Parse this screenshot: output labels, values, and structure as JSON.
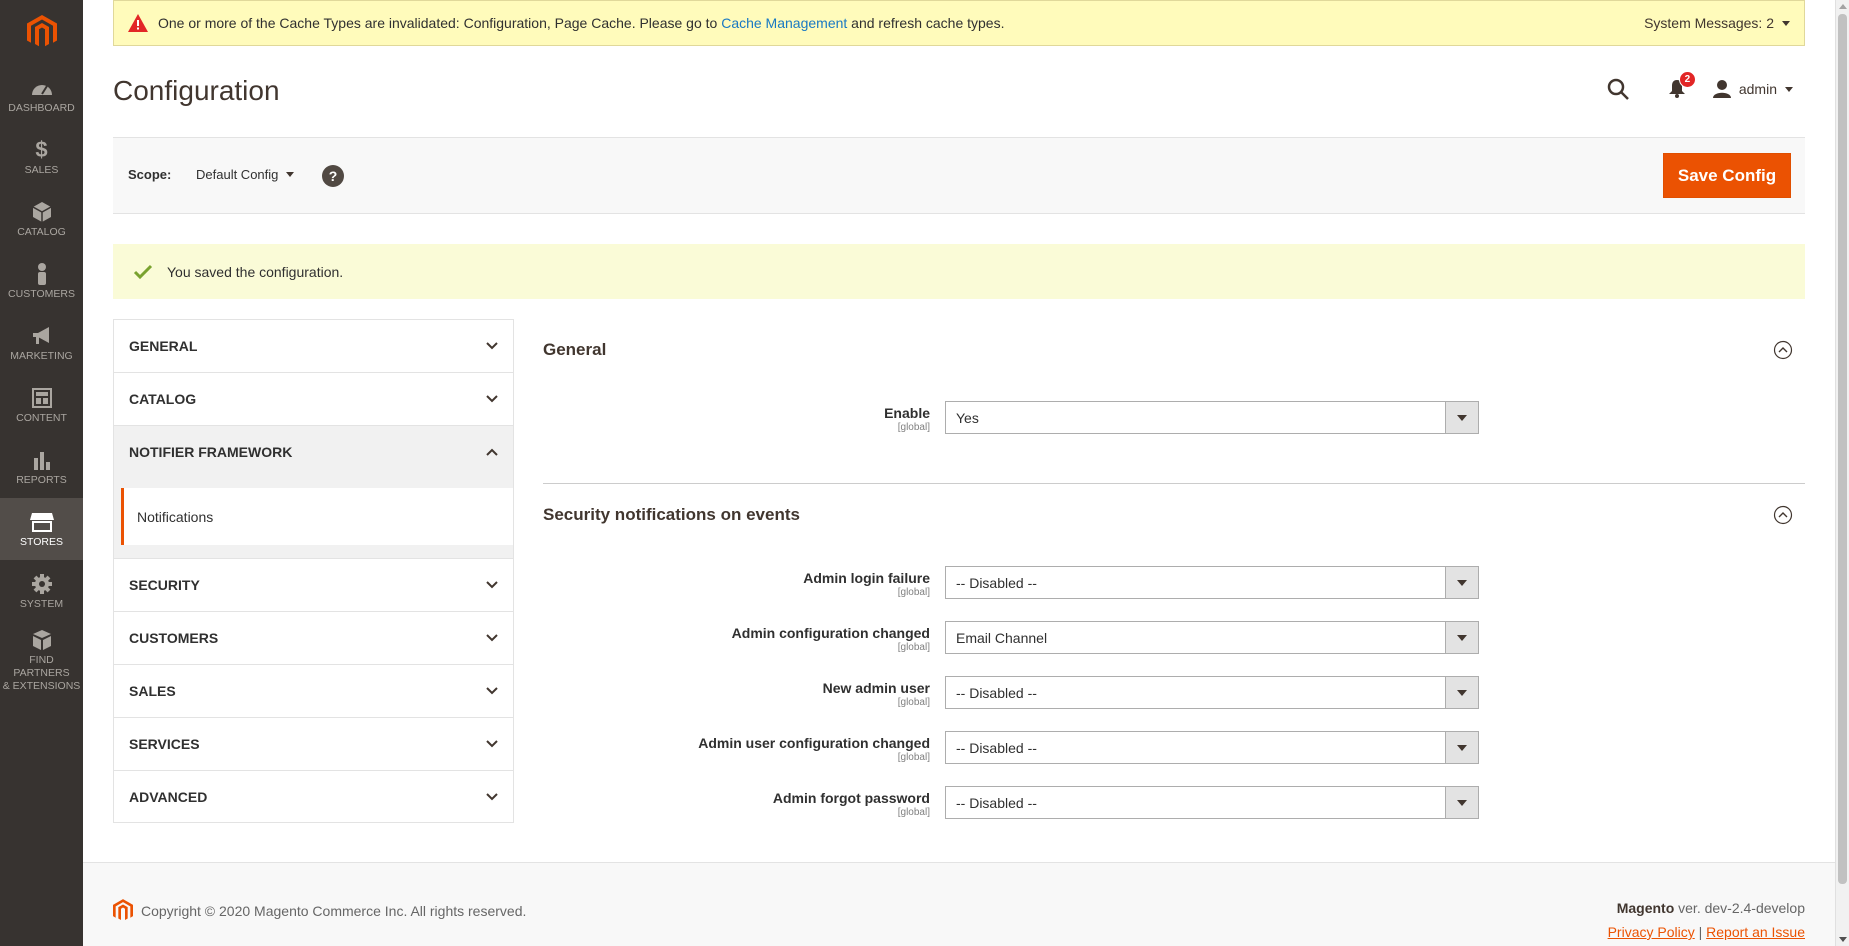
{
  "sidebar": {
    "items": [
      {
        "label": "DASHBOARD",
        "icon": "dashboard-icon"
      },
      {
        "label": "SALES",
        "icon": "dollar-icon"
      },
      {
        "label": "CATALOG",
        "icon": "cube-icon"
      },
      {
        "label": "CUSTOMERS",
        "icon": "person-icon"
      },
      {
        "label": "MARKETING",
        "icon": "megaphone-icon"
      },
      {
        "label": "CONTENT",
        "icon": "layout-icon"
      },
      {
        "label": "REPORTS",
        "icon": "bar-chart-icon"
      },
      {
        "label": "STORES",
        "icon": "store-icon"
      },
      {
        "label": "SYSTEM",
        "icon": "gear-icon"
      },
      {
        "label1": "FIND PARTNERS",
        "label2": "& EXTENSIONS",
        "icon": "boxes-icon"
      }
    ]
  },
  "system_message": {
    "text_before": "One or more of the Cache Types are invalidated: Configuration, Page Cache. Please go to ",
    "link": "Cache Management",
    "text_after": " and refresh cache types.",
    "count_label": "System Messages: 2"
  },
  "header": {
    "title": "Configuration",
    "notifications_count": "2",
    "user": "admin"
  },
  "scope": {
    "label": "Scope:",
    "value": "Default Config",
    "help": "?",
    "save_label": "Save Config"
  },
  "success_message": "You saved the configuration.",
  "tabs": {
    "general": "GENERAL",
    "catalog": "CATALOG",
    "notifier": "NOTIFIER FRAMEWORK",
    "notifications": "Notifications",
    "security": "SECURITY",
    "customers": "CUSTOMERS",
    "sales": "SALES",
    "services": "SERVICES",
    "advanced": "ADVANCED"
  },
  "sections": {
    "general": {
      "title": "General",
      "fields": [
        {
          "label": "Enable",
          "scope": "[global]",
          "value": "Yes"
        }
      ]
    },
    "security": {
      "title": "Security notifications on events",
      "fields": [
        {
          "label": "Admin login failure",
          "scope": "[global]",
          "value": "-- Disabled --"
        },
        {
          "label": "Admin configuration changed",
          "scope": "[global]",
          "value": "Email Channel"
        },
        {
          "label": "New admin user",
          "scope": "[global]",
          "value": "-- Disabled --"
        },
        {
          "label": "Admin user configuration changed",
          "scope": "[global]",
          "value": "-- Disabled --"
        },
        {
          "label": "Admin forgot password",
          "scope": "[global]",
          "value": "-- Disabled --"
        }
      ]
    }
  },
  "footer": {
    "copyright": "Copyright © 2020 Magento Commerce Inc. All rights reserved.",
    "brand": "Magento",
    "version": " ver. dev-2.4-develop",
    "privacy": "Privacy Policy",
    "separator": " | ",
    "report": "Report an Issue"
  },
  "colors": {
    "accent": "#eb5202",
    "sidebar": "#373330",
    "link": "#1979c3"
  }
}
